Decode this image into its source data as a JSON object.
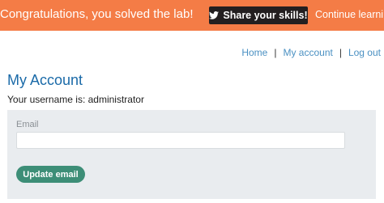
{
  "banner": {
    "message": "Congratulations, you solved the lab!",
    "share_label": "Share your skills!",
    "share_icon": "twitter-icon",
    "continue_label": "Continue learning",
    "background": "#f47c46"
  },
  "nav": {
    "home": "Home",
    "separator1": "|",
    "my_account": "My account",
    "separator2": "|",
    "logout": "Log out"
  },
  "page": {
    "title": "My Account",
    "username_line": "Your username is: administrator"
  },
  "form": {
    "email_label": "Email",
    "email_value": "",
    "email_placeholder": "",
    "submit_label": "Update email",
    "submit_color": "#3d8e77",
    "panel_color": "#e9ecef"
  }
}
